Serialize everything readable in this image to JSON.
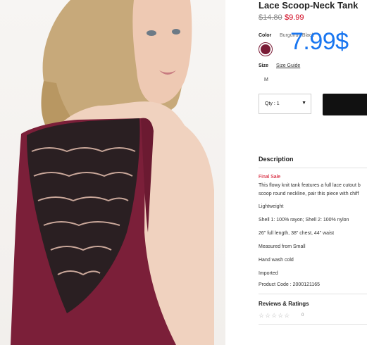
{
  "product": {
    "title": "Lace Scoop-Neck Tank",
    "old_price": "$14.80",
    "new_price": "$9.99",
    "overlay_price": "7.99$"
  },
  "color": {
    "label": "Color",
    "value": "Burgundy/Black",
    "swatch_color": "#7a1c36"
  },
  "size": {
    "label": "Size",
    "guide_link": "Size Guide",
    "options": [
      "M"
    ]
  },
  "quantity": {
    "label": "Qty : 1"
  },
  "description": {
    "title": "Description",
    "final_sale": "Final Sale",
    "text_line1": "This flowy knit tank features a full lace cutout b",
    "text_line2": "scoop round neckline, pair this piece with chiff",
    "details": [
      "Lightweight",
      "Shell 1: 100% rayon; Shell 2: 100% nylon",
      "26\" full length, 38\" chest, 44\" waist",
      "Measured from Small",
      "Hand wash cold",
      "Imported"
    ],
    "product_code": "Product Code : 2000121165"
  },
  "reviews": {
    "title": "Reviews & Ratings",
    "stars": "☆☆☆☆☆",
    "count": "0"
  }
}
